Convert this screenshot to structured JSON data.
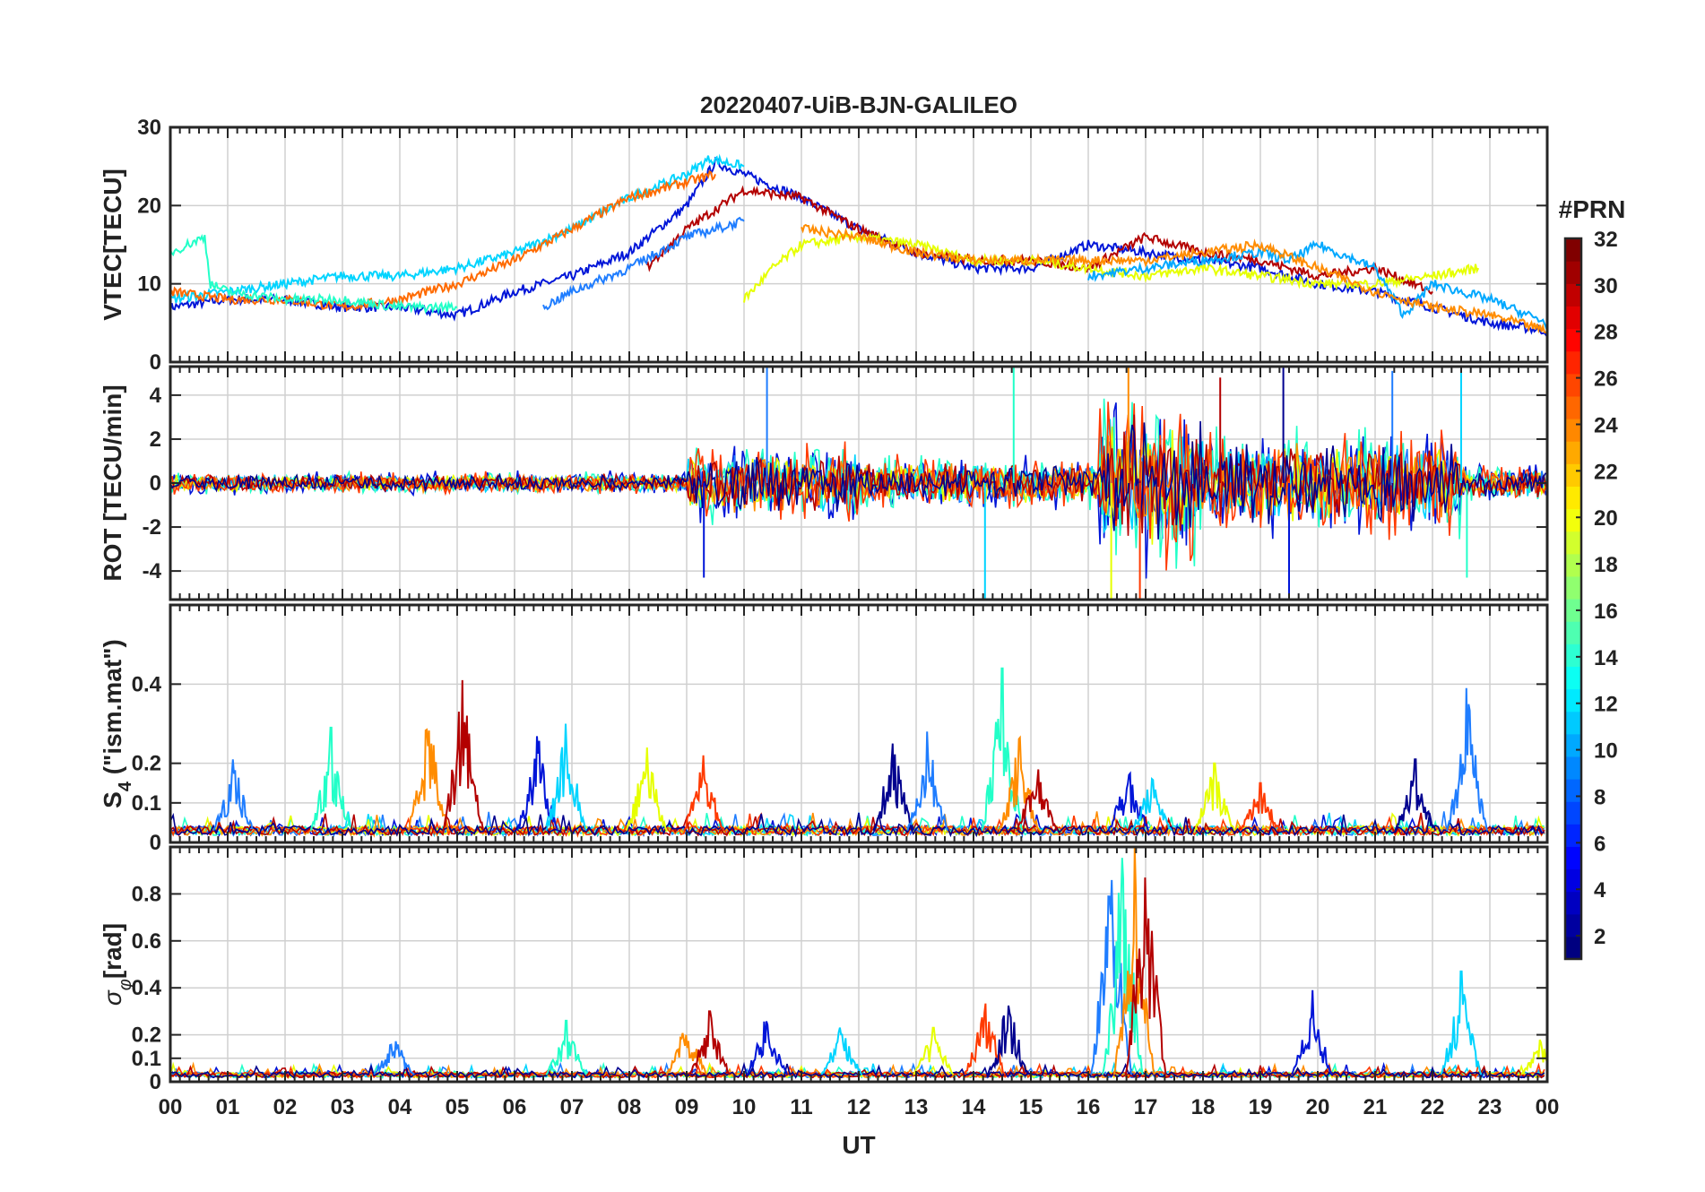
{
  "figure": {
    "title": "20220407-UiB-BJN-GALILEO",
    "xlabel": "UT",
    "x_tick_labels": [
      "00",
      "01",
      "02",
      "03",
      "04",
      "05",
      "06",
      "07",
      "08",
      "09",
      "10",
      "11",
      "12",
      "13",
      "14",
      "15",
      "16",
      "17",
      "18",
      "19",
      "20",
      "21",
      "22",
      "23",
      "00"
    ],
    "colorbar": {
      "title": "#PRN",
      "ticks": [
        2,
        4,
        6,
        8,
        10,
        12,
        14,
        16,
        18,
        20,
        22,
        24,
        26,
        28,
        30,
        32
      ],
      "range": [
        1,
        32
      ],
      "colormap": "jet"
    }
  },
  "chart_data": [
    {
      "type": "line",
      "panel": "vtec",
      "ylabel": "VTEC[TECU]",
      "ylim": [
        0,
        30
      ],
      "yticks": [
        0,
        10,
        20,
        30
      ],
      "xlim": [
        0,
        24
      ],
      "grid": true,
      "series": [
        {
          "prn": 3,
          "color": "#0015d8",
          "x": [
            0,
            1,
            2,
            3,
            4,
            5,
            6,
            7,
            8,
            9,
            9.5,
            10,
            11,
            12,
            13,
            14,
            15,
            16,
            17,
            18,
            19,
            20,
            21,
            22,
            23,
            24
          ],
          "y": [
            7,
            8,
            8,
            7,
            7,
            6,
            9,
            11,
            14,
            20,
            25.5,
            24,
            21,
            17,
            14,
            12,
            12,
            15,
            14,
            13,
            12,
            10,
            9,
            7,
            5,
            4
          ]
        },
        {
          "prn": 11,
          "color": "#00d4ff",
          "x": [
            0,
            1,
            2,
            3,
            4,
            5,
            6,
            7,
            8,
            9,
            9.4,
            10
          ],
          "y": [
            8,
            9,
            10,
            11,
            11,
            12,
            14,
            17,
            21,
            24,
            26,
            25
          ]
        },
        {
          "prn": 25,
          "color": "#ff6a00",
          "x": [
            0,
            1,
            2,
            3,
            4,
            5,
            6,
            7,
            8,
            9,
            9.5
          ],
          "y": [
            9,
            8,
            8,
            7,
            8,
            10,
            13,
            17,
            21,
            23,
            24
          ]
        },
        {
          "prn": 30,
          "color": "#b30000",
          "x": [
            8.3,
            9,
            10,
            11,
            12,
            13,
            14,
            15,
            16,
            17,
            18,
            19,
            20,
            21,
            22
          ],
          "y": [
            12,
            17,
            22,
            21,
            17,
            14,
            13,
            13,
            12,
            16,
            14,
            13,
            11,
            12,
            9
          ]
        },
        {
          "prn": 20,
          "color": "#e6ff00",
          "x": [
            10,
            10.5,
            11,
            12,
            13,
            14,
            15,
            16,
            17,
            18,
            19,
            20,
            21,
            22,
            22.8
          ],
          "y": [
            8,
            12,
            15,
            16,
            15,
            13,
            13,
            12,
            11,
            12,
            11,
            10,
            10,
            11,
            12
          ]
        },
        {
          "prn": 8,
          "color": "#1f7dff",
          "x": [
            6.5,
            7,
            8,
            9,
            10
          ],
          "y": [
            7,
            9,
            12,
            16,
            18
          ]
        },
        {
          "prn": 13,
          "color": "#22ffc8",
          "x": [
            0,
            0.6,
            0.7,
            1,
            2,
            3,
            4,
            5
          ],
          "y": [
            14,
            16,
            10,
            9,
            8,
            8,
            7,
            7
          ]
        },
        {
          "prn": 10,
          "color": "#00a8ff",
          "x": [
            16,
            17,
            18,
            19,
            19.5,
            20,
            21,
            21.5,
            22,
            23,
            24
          ],
          "y": [
            11,
            12,
            13,
            14,
            13,
            15,
            12,
            6,
            10,
            8,
            5
          ]
        },
        {
          "prn": 24,
          "color": "#ff8c00",
          "x": [
            11,
            12,
            13,
            14,
            15,
            16,
            17,
            18,
            19,
            20,
            21,
            22,
            23,
            24
          ],
          "y": [
            17,
            16,
            14,
            13,
            13,
            13,
            13,
            14,
            15,
            12,
            9,
            7,
            6,
            4
          ]
        }
      ]
    },
    {
      "type": "line",
      "panel": "rot",
      "ylabel": "ROT [TECU/min]",
      "ylim": [
        -5.3,
        5.3
      ],
      "yticks": [
        -4,
        -2,
        0,
        2,
        4
      ],
      "xlim": [
        0,
        24
      ],
      "grid": true,
      "bands": [
        {
          "x_start": 0,
          "x_end": 9,
          "amplitude": 0.6
        },
        {
          "x_start": 9,
          "x_end": 12,
          "amplitude": 2.0
        },
        {
          "x_start": 12,
          "x_end": 16.2,
          "amplitude": 1.4
        },
        {
          "x_start": 16.2,
          "x_end": 18,
          "amplitude": 4.5
        },
        {
          "x_start": 18,
          "x_end": 22.5,
          "amplitude": 2.8
        },
        {
          "x_start": 22.5,
          "x_end": 24,
          "amplitude": 1.0
        }
      ],
      "spikes": [
        {
          "x": 9.3,
          "y": -4.3
        },
        {
          "x": 10.4,
          "y": 5.3
        },
        {
          "x": 14.2,
          "y": -5.3
        },
        {
          "x": 14.7,
          "y": 5.3
        },
        {
          "x": 16.4,
          "y": -5.3
        },
        {
          "x": 16.7,
          "y": 5.3
        },
        {
          "x": 16.9,
          "y": -5.3
        },
        {
          "x": 18.3,
          "y": 4.8
        },
        {
          "x": 19.4,
          "y": 5.3
        },
        {
          "x": 19.5,
          "y": -5.3
        },
        {
          "x": 21.3,
          "y": 5.1
        },
        {
          "x": 22.5,
          "y": 5.3
        },
        {
          "x": 22.6,
          "y": -4.3
        }
      ]
    },
    {
      "type": "line",
      "panel": "s4",
      "ylabel": "S4 (\"ism.mat\")",
      "ylim": [
        0,
        0.6
      ],
      "yticks": [
        0,
        0.1,
        0.2,
        0.4
      ],
      "xlim": [
        0,
        24
      ],
      "grid": true,
      "baseline": 0.03,
      "peaks": [
        {
          "x": 1.1,
          "y": 0.21
        },
        {
          "x": 2.8,
          "y": 0.29
        },
        {
          "x": 4.5,
          "y": 0.34
        },
        {
          "x": 5.1,
          "y": 0.41
        },
        {
          "x": 6.4,
          "y": 0.28
        },
        {
          "x": 6.9,
          "y": 0.3
        },
        {
          "x": 8.3,
          "y": 0.24
        },
        {
          "x": 9.3,
          "y": 0.22
        },
        {
          "x": 12.6,
          "y": 0.25
        },
        {
          "x": 13.2,
          "y": 0.28
        },
        {
          "x": 14.5,
          "y": 0.44
        },
        {
          "x": 14.8,
          "y": 0.27
        },
        {
          "x": 15.1,
          "y": 0.2
        },
        {
          "x": 16.7,
          "y": 0.2
        },
        {
          "x": 17.1,
          "y": 0.17
        },
        {
          "x": 18.2,
          "y": 0.2
        },
        {
          "x": 19.0,
          "y": 0.15
        },
        {
          "x": 21.7,
          "y": 0.21
        },
        {
          "x": 22.6,
          "y": 0.39
        }
      ]
    },
    {
      "type": "line",
      "panel": "sigma_phi",
      "ylabel": "σφ[rad]",
      "ylim": [
        0,
        1
      ],
      "yticks": [
        0,
        0.1,
        0.2,
        0.4,
        0.6,
        0.8
      ],
      "xlim": [
        0,
        24
      ],
      "grid": true,
      "baseline": 0.03,
      "peaks": [
        {
          "x": 3.9,
          "y": 0.2
        },
        {
          "x": 6.9,
          "y": 0.26
        },
        {
          "x": 9.0,
          "y": 0.28
        },
        {
          "x": 9.4,
          "y": 0.3
        },
        {
          "x": 10.4,
          "y": 0.3
        },
        {
          "x": 11.7,
          "y": 0.26
        },
        {
          "x": 13.3,
          "y": 0.23
        },
        {
          "x": 14.2,
          "y": 0.35
        },
        {
          "x": 14.6,
          "y": 0.36
        },
        {
          "x": 16.4,
          "y": 1.0
        },
        {
          "x": 16.6,
          "y": 1.0
        },
        {
          "x": 16.8,
          "y": 1.0
        },
        {
          "x": 17.0,
          "y": 1.0
        },
        {
          "x": 19.9,
          "y": 0.39
        },
        {
          "x": 22.5,
          "y": 0.47
        },
        {
          "x": 23.9,
          "y": 0.2
        }
      ]
    }
  ]
}
